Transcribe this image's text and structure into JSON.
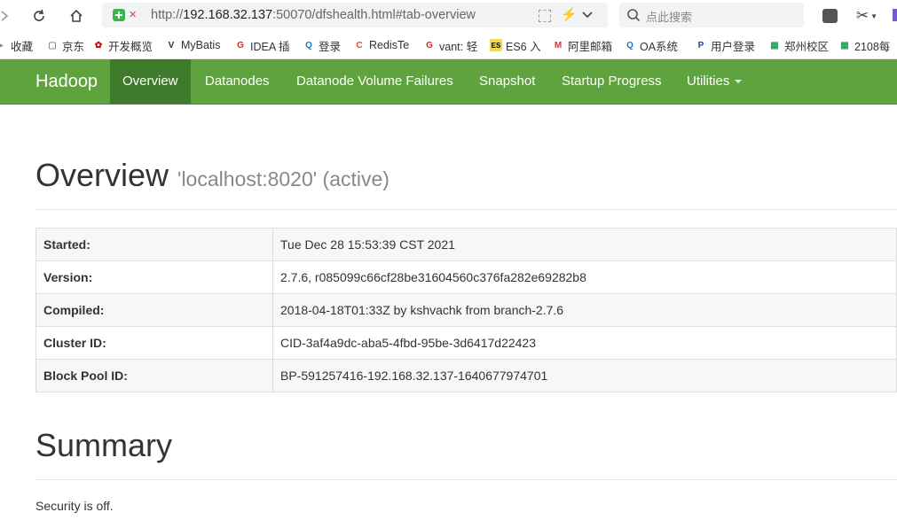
{
  "browser": {
    "url_prefix": "http://",
    "url_host": "192.168.32.137",
    "url_rest": ":50070/dfshealth.html#tab-overview",
    "search_placeholder": "点此搜索"
  },
  "bookmarks": [
    {
      "label": "收藏",
      "icon": "star-folder-icon",
      "color": "#888"
    },
    {
      "label": "京东",
      "icon": "page-icon",
      "color": "#888"
    },
    {
      "label": "开发概览",
      "icon": "huawei-icon",
      "color": "#c7000b"
    },
    {
      "label": "MyBatis",
      "icon": "mybatis-icon",
      "color": "#333"
    },
    {
      "label": "IDEA 插",
      "icon": "g-icon",
      "color": "#d62a2a"
    },
    {
      "label": "登录",
      "icon": "q-icon",
      "color": "#1d6fd8"
    },
    {
      "label": "RedisTe",
      "icon": "c-icon",
      "color": "#e14b2d"
    },
    {
      "label": "vant: 轻",
      "icon": "g-icon",
      "color": "#d62a2a"
    },
    {
      "label": "ES6 入",
      "icon": "es-icon",
      "color": "#f0db4f"
    },
    {
      "label": "阿里邮箱",
      "icon": "m-icon",
      "color": "#e0322f"
    },
    {
      "label": "OA系统",
      "icon": "q-icon",
      "color": "#1d6fd8"
    },
    {
      "label": "用户登录",
      "icon": "p-icon",
      "color": "#1f3d99"
    },
    {
      "label": "郑州校区",
      "icon": "sheet-icon",
      "color": "#22a35a"
    },
    {
      "label": "2108每",
      "icon": "sheet-icon",
      "color": "#22a35a"
    }
  ],
  "navbar": {
    "brand": "Hadoop",
    "items": [
      "Overview",
      "Datanodes",
      "Datanode Volume Failures",
      "Snapshot",
      "Startup Progress",
      "Utilities"
    ],
    "active": "Overview"
  },
  "overview": {
    "title": "Overview",
    "subtitle": "'localhost:8020' (active)",
    "rows": [
      {
        "key": "Started:",
        "value": "Tue Dec 28 15:53:39 CST 2021"
      },
      {
        "key": "Version:",
        "value": "2.7.6, r085099c66cf28be31604560c376fa282e69282b8"
      },
      {
        "key": "Compiled:",
        "value": "2018-04-18T01:33Z by kshvachk from branch-2.7.6"
      },
      {
        "key": "Cluster ID:",
        "value": "CID-3af4a9dc-aba5-4fbd-95be-3d6417d22423"
      },
      {
        "key": "Block Pool ID:",
        "value": "BP-591257416-192.168.32.137-1640677974701"
      }
    ]
  },
  "summary": {
    "title": "Summary",
    "security": "Security is off."
  },
  "colors": {
    "navbar": "#5fa33e",
    "navbar_active": "#3f7a2a"
  }
}
